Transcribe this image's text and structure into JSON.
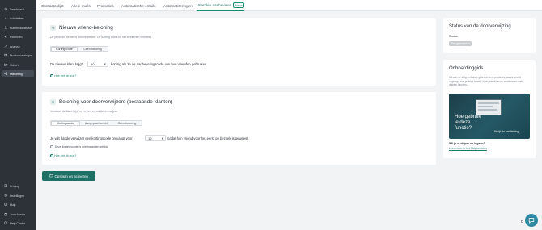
{
  "sidebar": {
    "items": [
      {
        "label": "Dashboard",
        "icon": "home-icon"
      },
      {
        "label": "Activiteiten",
        "icon": "bolt-icon"
      },
      {
        "label": "Klantendatabase",
        "icon": "user-icon"
      },
      {
        "label": "Financiën",
        "icon": "euro-icon"
      },
      {
        "label": "Analyse",
        "icon": "chart-icon"
      },
      {
        "label": "Productcatalogus",
        "icon": "box-icon"
      },
      {
        "label": "Video's",
        "icon": "video-icon"
      },
      {
        "label": "Marketing",
        "icon": "megaphone-icon"
      }
    ],
    "bottom_items": [
      {
        "label": "Privacy",
        "icon": "book-icon"
      },
      {
        "label": "Instellingen",
        "icon": "gear-icon"
      },
      {
        "label": "Hulp",
        "icon": "help-icon"
      },
      {
        "label": "Jouw bonus",
        "icon": "gift-icon"
      },
      {
        "label": "Help Center",
        "icon": "question-icon"
      }
    ]
  },
  "tabs": {
    "items": [
      "Contactenlijst",
      "Alle e-mails",
      "Promoties",
      "Automatische emails",
      "Automatiseringen",
      "Vrienden aanbevelen"
    ],
    "active_badge": "Nieuw"
  },
  "new_friend_card": {
    "title": "Nieuwe vriend-beloning",
    "subtitle": "De persoon die net is doorverwezen. De korting wordt bij het afrekenen verstrekt.",
    "options": [
      "Kortingscode",
      "Geen beloning"
    ],
    "sentence_before": "De nieuwe klant krijgt",
    "value": "10",
    "unit": "€",
    "sentence_after": "korting als ze de aanbevelingscode van hun vrienden gebruiken.",
    "link": "Hoe ziet dit eruit?"
  },
  "referrer_card": {
    "title": "Beloning voor doorverwijzers (bestaande klanten)",
    "subtitle": "Verstuurt de klant bij je is en een vriend doorverwijzer.",
    "options": [
      "Kortingscode",
      "Aangepast bericht",
      "Geen beloning"
    ],
    "sentence_before": "Je wilt dat de verwijzer een kortingscode ontvangt voor",
    "value": "10",
    "unit": "€",
    "sentence_after": "nadat hun vriend voor het eerst op bezoek is geweest.",
    "check_label": "Deze kortingscode is drie maanden geldig",
    "link": "Hoe ziet dit eruit?"
  },
  "save_button": {
    "label": "Opslaan en activeren"
  },
  "status_card": {
    "title": "Status van de doorverwijzing",
    "label": "Status",
    "badge": "Niet geactiveerd"
  },
  "onboarding_card": {
    "title": "Onboardinggids",
    "text": "Ga aan de slag met onze gids met best practices, waarin wordt uitgelegd hoe je deze functie kunt gebruiken en combineren met andere functies.",
    "video_text_line1": "Hoe gebruik",
    "video_text_line2": "je deze",
    "video_text_line3": "functie?",
    "video_cta": "Bekijk de handleiding",
    "question": "Wil je er dieper op ingaan?",
    "learn_link": "Lees meer in het Helpcentrum"
  },
  "colors": {
    "accent": "#1e6f64",
    "sidebar": "#2d3138",
    "help": "#2e8aa2"
  }
}
